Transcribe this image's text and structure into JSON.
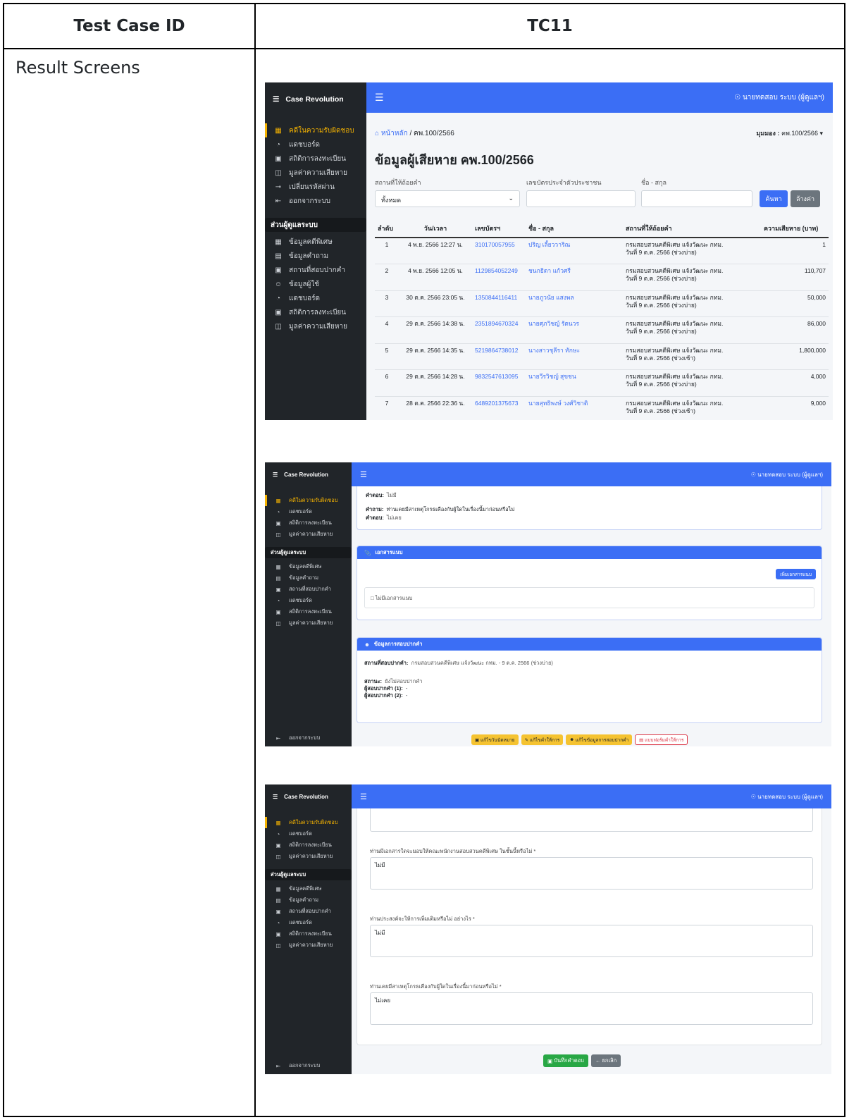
{
  "doc": {
    "header_label": "Test Case ID",
    "header_value": "TC11",
    "row_label": "Result Screens"
  },
  "app": {
    "brand": "Case Revolution",
    "user": "นายทดสอบ ระบบ (ผู้ดูแลฯ)",
    "menu_icon": "hamburger-icon",
    "user_icon": "user-circle-icon"
  },
  "sidebar": {
    "items": [
      {
        "icon": "grid-icon",
        "label": "คดีในความรับผิดชอบ"
      },
      {
        "icon": "dashboard-icon",
        "label": "แดชบอร์ด"
      },
      {
        "icon": "bar-chart-icon",
        "label": "สถิติการลงทะเบียน"
      },
      {
        "icon": "money-icon",
        "label": "มูลค่าความเสียหาย"
      }
    ],
    "password_item": "เปลี่ยนรหัสผ่าน",
    "logout": "ออกจากระบบ",
    "section": "ส่วนผู้ดูแลระบบ",
    "admin_items": [
      {
        "icon": "grid-icon",
        "label": "ข้อมูลคดีพิเศษ"
      },
      {
        "icon": "chat-icon",
        "label": "ข้อมูลคำถาม"
      },
      {
        "icon": "location-icon",
        "label": "สถานที่สอบปากคำ"
      },
      {
        "icon": "user-icon",
        "label": "ข้อมูลผู้ใช้"
      },
      {
        "icon": "dashboard-icon",
        "label": "แดชบอร์ด"
      },
      {
        "icon": "bar-chart-icon",
        "label": "สถิติการลงทะเบียน"
      },
      {
        "icon": "money-icon",
        "label": "มูลค่าความเสียหาย"
      }
    ]
  },
  "screen1": {
    "breadcrumb_home": "หน้าหลัก",
    "breadcrumb_current": "/ คพ.100/2566",
    "view_label": "มุมมอง :",
    "view_value": "คพ.100/2566",
    "title": "ข้อมูลผู้เสียหาย คพ.100/2566",
    "filters": {
      "location_label": "สถานที่ให้ถ้อยคำ",
      "location_value": "ทั้งหมด",
      "id_label": "เลขบัตรประจำตัวประชาชน",
      "name_label": "ชื่อ - สกุล",
      "search_btn": "ค้นหา",
      "clear_btn": "ล้างค่า"
    },
    "columns": [
      "ลำดับ",
      "วัน/เวลา",
      "เลขบัตรฯ",
      "ชื่อ - สกุล",
      "สถานที่ให้ถ้อยคำ",
      "ความเสียหาย (บาท)"
    ],
    "rows": [
      {
        "no": "1",
        "datetime": "4 พ.ย. 2566 12:27 น.",
        "id": "310170057955",
        "name": "ปริญ เลี้ยววาริณ",
        "place1": "กรมสอบสวนคดีพิเศษ แจ้งวัฒนะ กทม.",
        "place2": "วันที่ 9 ต.ค. 2566 (ช่วงบ่าย)",
        "loss": "1"
      },
      {
        "no": "2",
        "datetime": "4 พ.ย. 2566 12:05 น.",
        "id": "1129854052249",
        "name": "ชนกธิดา แก้วศรี",
        "place1": "กรมสอบสวนคดีพิเศษ แจ้งวัฒนะ กทม.",
        "place2": "วันที่ 9 ต.ค. 2566 (ช่วงบ่าย)",
        "loss": "110,707"
      },
      {
        "no": "3",
        "datetime": "30 ต.ค. 2566 23:05 น.",
        "id": "1350844116411",
        "name": "นายภูวนัย แสงพล",
        "place1": "กรมสอบสวนคดีพิเศษ แจ้งวัฒนะ กทม.",
        "place2": "วันที่ 9 ต.ค. 2566 (ช่วงบ่าย)",
        "loss": "50,000"
      },
      {
        "no": "4",
        "datetime": "29 ต.ค. 2566 14:38 น.",
        "id": "2351894670324",
        "name": "นายศุภวิชญ์ รัตนวร",
        "place1": "กรมสอบสวนคดีพิเศษ แจ้งวัฒนะ กทม.",
        "place2": "วันที่ 9 ต.ค. 2566 (ช่วงบ่าย)",
        "loss": "86,000"
      },
      {
        "no": "5",
        "datetime": "29 ต.ค. 2566 14:35 น.",
        "id": "5219864738012",
        "name": "นางสาวชุลีรา ทักษะ",
        "place1": "กรมสอบสวนคดีพิเศษ แจ้งวัฒนะ กทม.",
        "place2": "วันที่ 9 ต.ค. 2566 (ช่วงเช้า)",
        "loss": "1,800,000"
      },
      {
        "no": "6",
        "datetime": "29 ต.ค. 2566 14:28 น.",
        "id": "9832547613095",
        "name": "นายวีรวิชญ์ สุขชน",
        "place1": "กรมสอบสวนคดีพิเศษ แจ้งวัฒนะ กทม.",
        "place2": "วันที่ 9 ต.ค. 2566 (ช่วงบ่าย)",
        "loss": "4,000"
      },
      {
        "no": "7",
        "datetime": "28 ต.ค. 2566 22:36 น.",
        "id": "6489201375673",
        "name": "นายสุทธิพงษ์ วงศ์วิชาติ",
        "place1": "กรมสอบสวนคดีพิเศษ แจ้งวัฒนะ กทม.",
        "place2": "วันที่ 9 ต.ค. 2566 (ช่วงเช้า)",
        "loss": "9,000"
      }
    ]
  },
  "screen2": {
    "qa": [
      {
        "q_label": "คำถาม:",
        "q": "ท่านมีเอกสารใดจะมอบให้คณะพนักงานสอบสวนคดีพิเศษ ในชั้นนี้หรือไม่",
        "a_label": "คำตอบ:",
        "a": "ไม่มี"
      },
      {
        "q_label": "คำถาม:",
        "q": "ท่านเคยมีสาเหตุโกรธเคืองกับผู้ใดในเรื่องนี้มาก่อนหรือไม่",
        "a_label": "คำตอบ:",
        "a": "ไม่เคย"
      }
    ],
    "attach": {
      "title": "เอกสารแนบ",
      "add_btn": "เพิ่มเอกสารแนบ",
      "empty": "ไม่มีเอกสารแนบ"
    },
    "interview": {
      "title": "ข้อมูลการสอบปากคำ",
      "place_label": "สถานที่สอบปากคำ:",
      "place": "กรมสอบสวนคดีพิเศษ แจ้งวัฒนะ กทม. - 9 ต.ค. 2566 (ช่วงบ่าย)",
      "status_label": "สถานะ:",
      "status": "ยังไม่สอบปากคำ",
      "int1_label": "ผู้สอบปากคำ (1):",
      "int1": "-",
      "int2_label": "ผู้สอบปากคำ (2):",
      "int2": "-"
    },
    "buttons": [
      "แก้ไขวันนัดหมาย",
      "แก้ไขคำให้การ",
      "แก้ไขข้อมูลการสอบปากคำ",
      "แบบฟอร์มคำให้การ"
    ]
  },
  "screen3": {
    "questions": [
      {
        "q": "ท่านมีเอกสารใดจะมอบให้คณะพนักงานสอบสวนคดีพิเศษ ในชั้นนี้หรือไม่ *",
        "a": "ไม่มี"
      },
      {
        "q": "ท่านประสงค์จะให้การเพิ่มเติมหรือไม่ อย่างไร *",
        "a": "ไม่มี"
      },
      {
        "q": "ท่านเคยมีสาเหตุโกรธเคืองกับผู้ใดในเรื่องนี้มาก่อนหรือไม่ *",
        "a": "ไม่เคย"
      }
    ],
    "save_btn": "บันทึกคำตอบ",
    "cancel_btn": "← ยกเลิก"
  }
}
